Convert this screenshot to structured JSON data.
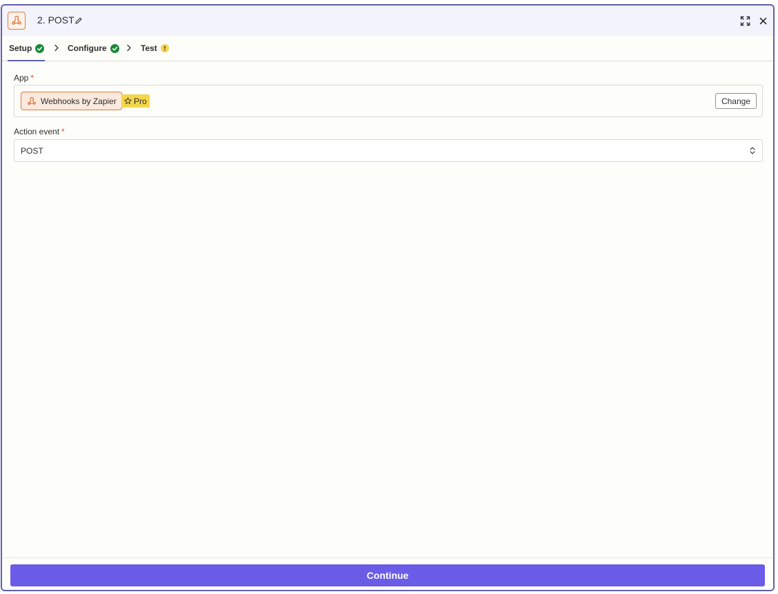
{
  "header": {
    "step_title": "2. POST"
  },
  "tabs": [
    {
      "label": "Setup",
      "status": "complete",
      "active": true
    },
    {
      "label": "Configure",
      "status": "complete",
      "active": false
    },
    {
      "label": "Test",
      "status": "warning",
      "active": false
    }
  ],
  "app_field": {
    "label": "App",
    "required_mark": "*",
    "app_name": "Webhooks by Zapier",
    "badge": "Pro",
    "change_label": "Change"
  },
  "action_field": {
    "label": "Action event",
    "required_mark": "*",
    "value": "POST"
  },
  "footer": {
    "continue_label": "Continue"
  },
  "icons": {
    "app": "webhook-icon",
    "edit": "pencil-icon",
    "expand": "expand-icon",
    "close": "close-icon",
    "complete": "check-circle-icon",
    "warning": "exclamation-circle-icon",
    "separator": "chevron-right-icon",
    "badge": "star-icon",
    "select": "updown-chevron-icon"
  },
  "colors": {
    "accent": "#6b5ce7",
    "panel_border": "#5f5fae",
    "app_brand": "#e07a3f",
    "complete": "#1b8a3a",
    "warning": "#f4d54b",
    "required": "#d9473d"
  }
}
